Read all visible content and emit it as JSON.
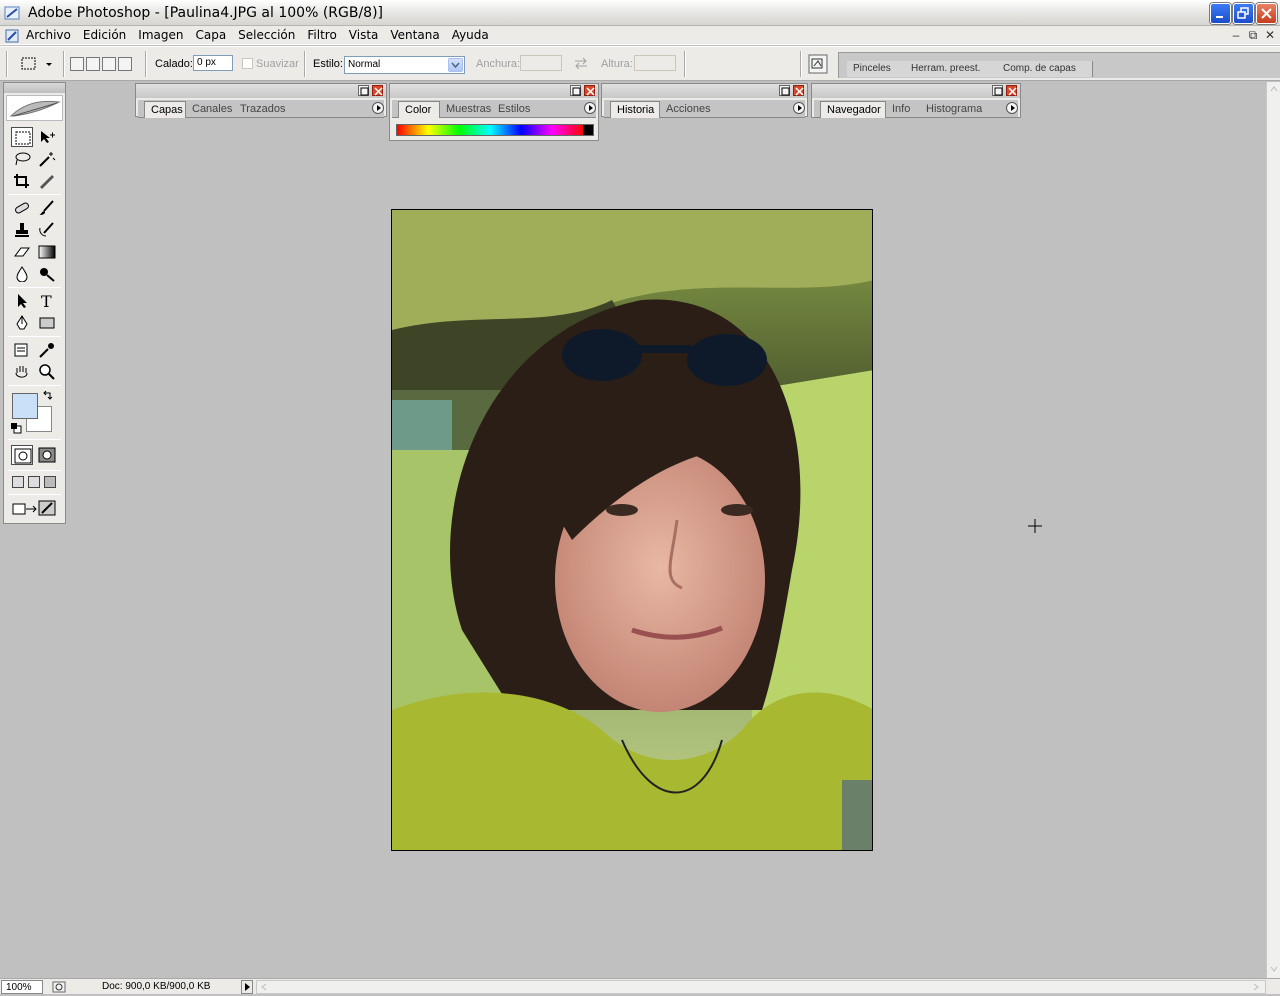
{
  "window": {
    "title": "Adobe Photoshop - [Paulina4.JPG al 100% (RGB/8)]"
  },
  "menu": {
    "items": [
      "Archivo",
      "Edición",
      "Imagen",
      "Capa",
      "Selección",
      "Filtro",
      "Vista",
      "Ventana",
      "Ayuda"
    ]
  },
  "options": {
    "feather_label": "Calado:",
    "feather_value": "0 px",
    "antialias_label": "Suavizar",
    "style_label": "Estilo:",
    "style_value": "Normal",
    "width_label": "Anchura:",
    "height_label": "Altura:"
  },
  "palette_well": {
    "tabs": [
      "Pinceles",
      "Herram. preest.",
      "Comp. de capas"
    ]
  },
  "palettes": {
    "layers": {
      "tabs": [
        "Capas",
        "Canales",
        "Trazados"
      ]
    },
    "color": {
      "tabs": [
        "Color",
        "Muestras",
        "Estilos"
      ]
    },
    "history": {
      "tabs": [
        "Historia",
        "Acciones"
      ]
    },
    "navigator": {
      "tabs": [
        "Navegador",
        "Info",
        "Histograma"
      ]
    }
  },
  "colors": {
    "foreground": "#c8e0f8",
    "background": "#ffffff",
    "canvas_bg": "#c0c0c0"
  },
  "document": {
    "filename": "Paulina4.JPG",
    "zoom": "100%",
    "doc_info": "Doc: 900,0 KB/900,0 KB"
  }
}
